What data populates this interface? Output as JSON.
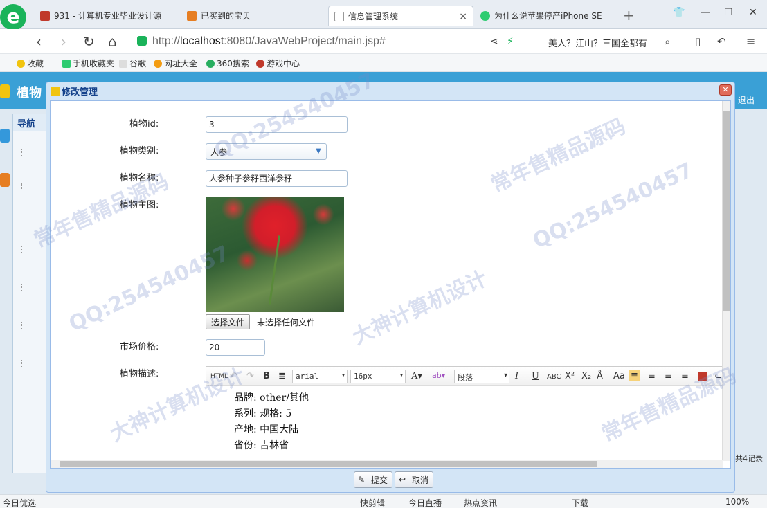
{
  "browser": {
    "logo": "e",
    "tabs": [
      {
        "label": "931 - 计算机专业毕业设计源",
        "active": false
      },
      {
        "label": "已买到的宝贝",
        "active": false
      },
      {
        "label": "信息管理系统",
        "active": true
      },
      {
        "label": "为什么说苹果停产iPhone SE",
        "active": false
      }
    ],
    "new_tab": "+",
    "url_prefix": "http://",
    "url_host": "localhost",
    "url_rest": ":8080/JavaWebProject/main.jsp#",
    "search_hint": "美人？江山？三国全都有"
  },
  "bookmarks": [
    "收藏",
    "手机收藏夹",
    "谷歌",
    "网址大全",
    "360搜索",
    "游戏中心"
  ],
  "app": {
    "title": "植物",
    "logout": "退出",
    "nav_header": "导航",
    "records": "共4记录"
  },
  "modal": {
    "title": "修改管理",
    "close": "✕",
    "fields": {
      "id_label": "植物id:",
      "id_value": "3",
      "type_label": "植物类别:",
      "type_value": "人参",
      "name_label": "植物名称:",
      "name_value": "人参种子参籽西洋参籽",
      "image_label": "植物主图:",
      "file_button": "选择文件",
      "file_status": "未选择任何文件",
      "price_label": "市场价格:",
      "price_value": "20",
      "desc_label": "植物描述:"
    },
    "editor": {
      "html_btn": "HTML",
      "font": "arial",
      "size": "16px",
      "paragraph": "段落",
      "lines": [
        "品牌: other/其他",
        "系列: 规格: 5",
        "产地: 中国大陆",
        "省份: 吉林省"
      ]
    },
    "submit": "提交",
    "cancel": "取消"
  },
  "statusbar": {
    "left": "今日优选",
    "items": [
      "快剪辑",
      "今日直播",
      "热点资讯",
      "下载"
    ],
    "zoom": "100%"
  },
  "watermarks": [
    "QQ:254540457",
    "常年售精品源码",
    "大神计算机设计",
    "QQ:254540457",
    "常年售精品源码",
    "大神计算机设计",
    "QQ:254540457",
    "常年售精品源码"
  ]
}
